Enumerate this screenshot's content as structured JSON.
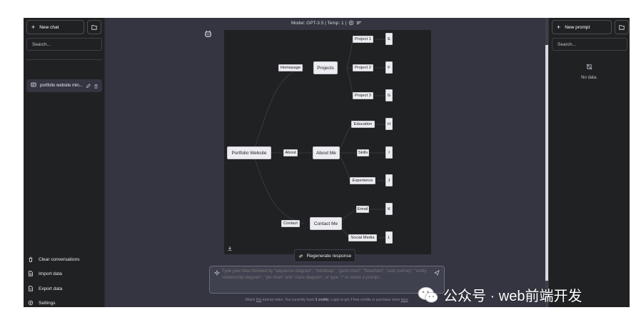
{
  "left_sidebar": {
    "new_chat_label": "New chat",
    "search_placeholder": "Search...",
    "conversations": [
      {
        "title": "portfolio website min..."
      }
    ],
    "menu": [
      {
        "label": "Clear conversations",
        "icon": "trash-icon"
      },
      {
        "label": "Import data",
        "icon": "file-import-icon"
      },
      {
        "label": "Export data",
        "icon": "file-export-icon"
      },
      {
        "label": "Settings",
        "icon": "settings-icon"
      }
    ]
  },
  "header": {
    "model_text": "Model: GPT-3.5 | Temp: 1 |"
  },
  "mindmap": {
    "root": "Portfolio Website",
    "edge_labels": [
      "Homepage",
      "About",
      "Contact"
    ],
    "branches": [
      "Projects",
      "About Me",
      "Contact Me"
    ],
    "subitems": [
      "Project 1",
      "Project 2",
      "Project 3",
      "Education",
      "Skills",
      "Experience",
      "Email",
      "Social Media"
    ],
    "leaves": [
      "E",
      "F",
      "G",
      "H",
      "I",
      "J",
      "K",
      "L"
    ]
  },
  "regenerate_label": "Regenerate response",
  "input": {
    "placeholder": "Type your idea followed by \"sequence diagram\", \"mindmap\", \"gantt chart\", \"flowchart\", \"user journey\", \"entity relationship diagram\", \"pie chart\" and \"class diagram\", or type \"/\" to select a prompt..."
  },
  "footer": {
    "prefix": "Watch ",
    "link1": "this",
    "middle": " tutorial video. You currently have ",
    "credits": "3 credits",
    "suffix": ". Login to get 3 free credits or purchase more ",
    "link2": "here"
  },
  "right_sidebar": {
    "new_prompt_label": "New prompt",
    "search_placeholder": "Search...",
    "empty_text": "No data."
  },
  "watermark": {
    "text": "公众号 · web前端开发"
  },
  "colors": {
    "app_bg": "#343541",
    "sidebar_bg": "#202123",
    "node_bg": "#ececf1",
    "border": "#4d4d4f"
  }
}
